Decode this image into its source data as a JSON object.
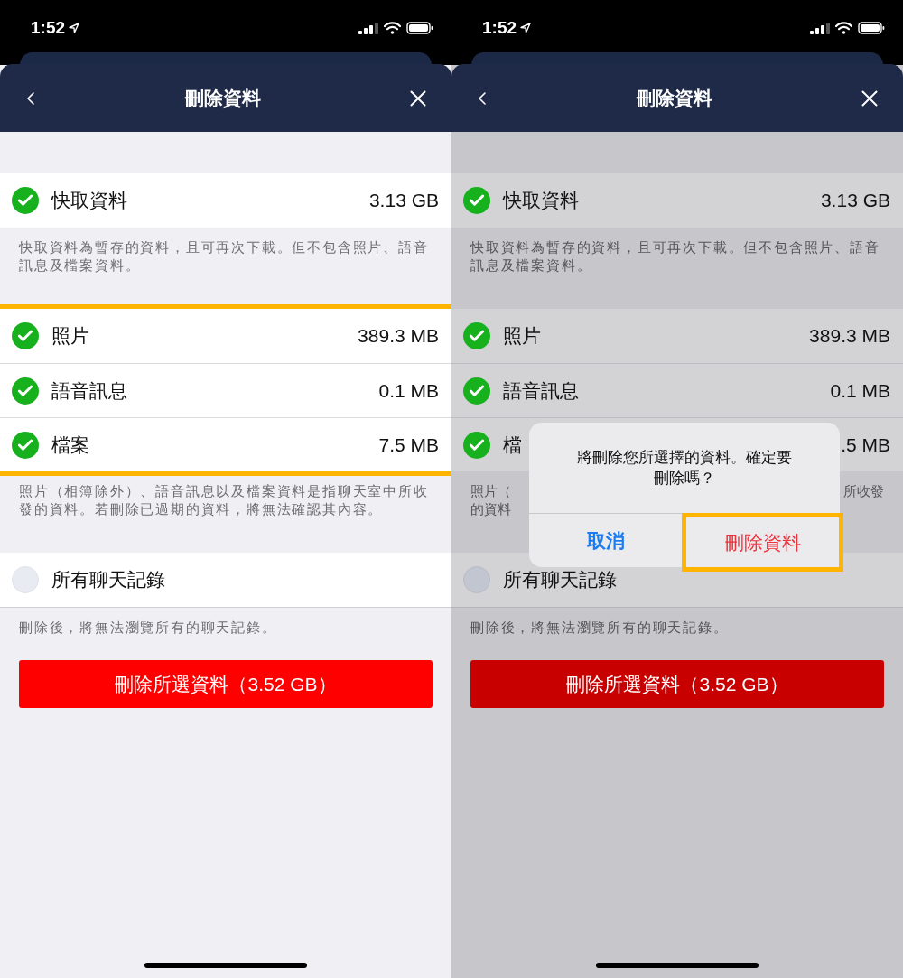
{
  "screens": [
    {
      "status_bar": {
        "time": "1:52"
      },
      "header": {
        "title": "刪除資料"
      },
      "dimmed": false,
      "sections": [
        {
          "highlighted": false,
          "rows": [
            {
              "label": "快取資料",
              "size": "3.13 GB",
              "checked": true
            }
          ],
          "note": "快取資料為暫存的資料，且可再次下載。但不包含照片、語音訊息及檔案資料。"
        },
        {
          "highlighted": true,
          "rows": [
            {
              "label": "照片",
              "size": "389.3 MB",
              "checked": true
            },
            {
              "label": "語音訊息",
              "size": "0.1 MB",
              "checked": true
            },
            {
              "label": "檔案",
              "size": "7.5 MB",
              "checked": true
            }
          ],
          "note": "照片（相簿除外）、語音訊息以及檔案資料是指聊天室中所收發的資料。若刪除已過期的資料，將無法確認其內容。"
        },
        {
          "highlighted": false,
          "rows": [
            {
              "label": "所有聊天記錄",
              "checked": false
            }
          ],
          "note": "刪除後，將無法瀏覽所有的聊天記錄。"
        }
      ],
      "delete_button": {
        "label": "刪除所選資料（3.52 GB）"
      }
    },
    {
      "status_bar": {
        "time": "1:52"
      },
      "header": {
        "title": "刪除資料"
      },
      "dimmed": true,
      "sections": [
        {
          "highlighted": false,
          "rows": [
            {
              "label": "快取資料",
              "size": "3.13 GB",
              "checked": true
            }
          ],
          "note": "快取資料為暫存的資料，且可再次下載。但不包含照片、語音訊息及檔案資料。"
        },
        {
          "highlighted": false,
          "rows": [
            {
              "label": "照片",
              "size": "389.3 MB",
              "checked": true
            },
            {
              "label": "語音訊息",
              "size": "0.1 MB",
              "checked": true
            },
            {
              "label": "檔",
              "size": ".5 MB",
              "checked": true
            }
          ],
          "note": {
            "left": [
              "照片（",
              "的資料"
            ],
            "right": [
              "所收發"
            ]
          }
        },
        {
          "highlighted": false,
          "rows": [
            {
              "label": "所有聊天記錄",
              "checked": false
            }
          ],
          "note": "刪除後，將無法瀏覽所有的聊天記錄。"
        }
      ],
      "delete_button": {
        "label": "刪除所選資料（3.52 GB）"
      },
      "dialog": {
        "message": "將刪除您所選擇的資料。確定要刪除嗎？",
        "buttons": [
          {
            "label": "取消",
            "kind": "cancel",
            "highlighted": false
          },
          {
            "label": "刪除資料",
            "kind": "destructive",
            "highlighted": true
          }
        ]
      }
    }
  ]
}
